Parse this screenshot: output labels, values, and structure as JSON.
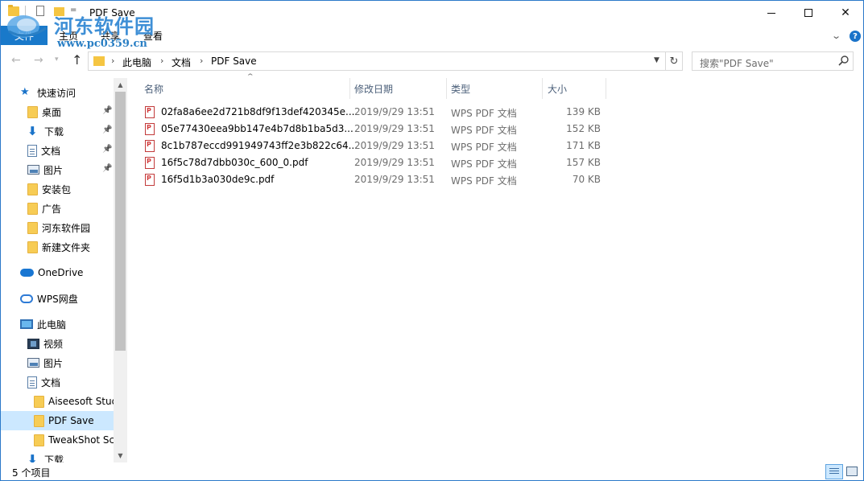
{
  "window": {
    "title": "PDF Save",
    "quick_access_dropdown": "="
  },
  "watermark": {
    "name": "河东软件园",
    "url": "www.pc0359.cn"
  },
  "ribbon": {
    "tabs": [
      {
        "label": "文件"
      },
      {
        "label": "主页"
      },
      {
        "label": "共享"
      },
      {
        "label": "查看"
      }
    ],
    "help": "?"
  },
  "address_bar": {
    "crumbs": [
      "此电脑",
      "文档",
      "PDF Save"
    ],
    "search_placeholder": "搜索\"PDF Save\""
  },
  "nav_pane": {
    "items": [
      {
        "label": "快速访问",
        "icon": "star-icon",
        "indent": 0,
        "pinned": false
      },
      {
        "label": "桌面",
        "icon": "folder-icon",
        "indent": 1,
        "pinned": true
      },
      {
        "label": "下载",
        "icon": "download-icon",
        "indent": 1,
        "pinned": true
      },
      {
        "label": "文档",
        "icon": "document-icon",
        "indent": 1,
        "pinned": true
      },
      {
        "label": "图片",
        "icon": "picture-icon",
        "indent": 1,
        "pinned": true
      },
      {
        "label": "安装包",
        "icon": "folder-icon",
        "indent": 1,
        "pinned": false
      },
      {
        "label": "广告",
        "icon": "folder-icon",
        "indent": 1,
        "pinned": false
      },
      {
        "label": "河东软件园",
        "icon": "folder-icon",
        "indent": 1,
        "pinned": false
      },
      {
        "label": "新建文件夹",
        "icon": "folder-icon",
        "indent": 1,
        "pinned": false
      },
      {
        "label": "OneDrive",
        "icon": "onedrive-icon",
        "indent": 0,
        "pinned": false
      },
      {
        "label": "WPS网盘",
        "icon": "cloud-icon",
        "indent": 0,
        "pinned": false
      },
      {
        "label": "此电脑",
        "icon": "computer-icon",
        "indent": 0,
        "pinned": false
      },
      {
        "label": "视频",
        "icon": "video-icon",
        "indent": 1,
        "pinned": false
      },
      {
        "label": "图片",
        "icon": "picture-icon",
        "indent": 1,
        "pinned": false
      },
      {
        "label": "文档",
        "icon": "document-icon",
        "indent": 1,
        "pinned": false
      },
      {
        "label": "Aiseesoft Studio",
        "icon": "folder-icon",
        "indent": 2,
        "pinned": false
      },
      {
        "label": "PDF Save",
        "icon": "folder-icon",
        "indent": 2,
        "pinned": false,
        "selected": true
      },
      {
        "label": "TweakShot Screen",
        "icon": "folder-icon",
        "indent": 2,
        "pinned": false
      },
      {
        "label": "下载",
        "icon": "download-icon",
        "indent": 1,
        "pinned": false
      }
    ]
  },
  "file_list": {
    "columns": [
      "名称",
      "修改日期",
      "类型",
      "大小"
    ],
    "rows": [
      {
        "name": "02fa8a6ee2d721b8df9f13def420345e...",
        "date": "2019/9/29 13:51",
        "type": "WPS PDF 文档",
        "size": "139 KB"
      },
      {
        "name": "05e77430eea9bb147e4b7d8b1ba5d3...",
        "date": "2019/9/29 13:51",
        "type": "WPS PDF 文档",
        "size": "152 KB"
      },
      {
        "name": "8c1b787eccd991949743ff2e3b822c64...",
        "date": "2019/9/29 13:51",
        "type": "WPS PDF 文档",
        "size": "171 KB"
      },
      {
        "name": "16f5c78d7dbb030c_600_0.pdf",
        "date": "2019/9/29 13:51",
        "type": "WPS PDF 文档",
        "size": "157 KB"
      },
      {
        "name": "16f5d1b3a030de9c.pdf",
        "date": "2019/9/29 13:51",
        "type": "WPS PDF 文档",
        "size": "70 KB"
      }
    ]
  },
  "status_bar": {
    "item_count": "5 个项目"
  },
  "colors": {
    "accent": "#1979ca",
    "selection": "#cce8ff",
    "watermark": "#3e8fd6"
  }
}
